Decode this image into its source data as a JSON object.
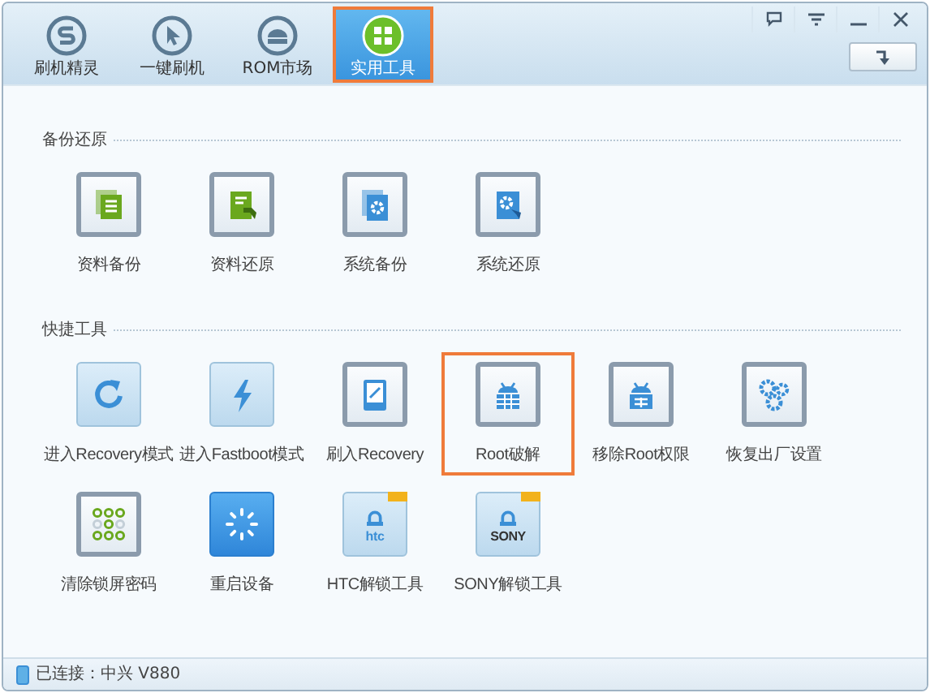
{
  "tabs": [
    {
      "label": "刷机精灵",
      "selected": false
    },
    {
      "label": "一键刷机",
      "selected": false
    },
    {
      "label": "ROM市场",
      "selected": false
    },
    {
      "label": "实用工具",
      "selected": true
    }
  ],
  "sections": [
    {
      "title": "备份还原",
      "items": [
        {
          "label": "资料备份",
          "kind": "framed",
          "selected": false
        },
        {
          "label": "资料还原",
          "kind": "framed",
          "selected": false
        },
        {
          "label": "系统备份",
          "kind": "framed",
          "selected": false
        },
        {
          "label": "系统还原",
          "kind": "framed",
          "selected": false
        }
      ]
    },
    {
      "title": "快捷工具",
      "items": [
        {
          "label": "进入Recovery模式",
          "kind": "light",
          "selected": false
        },
        {
          "label": "进入Fastboot模式",
          "kind": "light",
          "selected": false
        },
        {
          "label": "刷入Recovery",
          "kind": "framed",
          "selected": false
        },
        {
          "label": "Root破解",
          "kind": "framed",
          "selected": true
        },
        {
          "label": "移除Root权限",
          "kind": "framed",
          "selected": false
        },
        {
          "label": "恢复出厂设置",
          "kind": "framed",
          "selected": false
        },
        {
          "label": "清除锁屏密码",
          "kind": "framed",
          "selected": false
        },
        {
          "label": "重启设备",
          "kind": "solid",
          "selected": false
        },
        {
          "label": "HTC解锁工具",
          "kind": "light",
          "selected": false,
          "new": true,
          "icon_text": "htc"
        },
        {
          "label": "SONY解锁工具",
          "kind": "light",
          "selected": false,
          "new": true,
          "icon_text": "SONY"
        }
      ]
    }
  ],
  "status_bar": {
    "text": "已连接：中兴 V880"
  }
}
